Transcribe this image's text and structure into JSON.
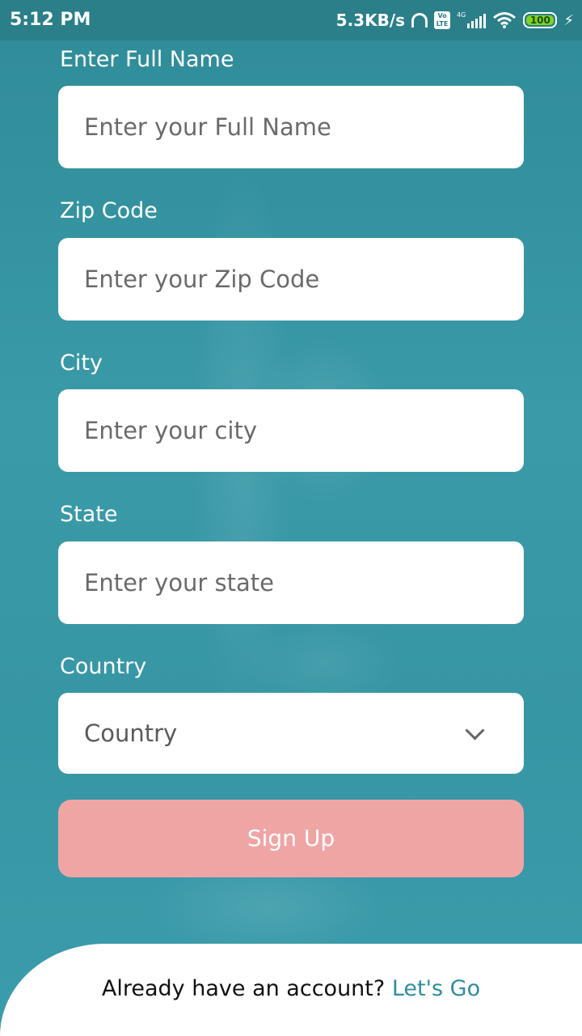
{
  "status_bar": {
    "time": "5:12 PM",
    "net_speed": "5.3KB/s",
    "volte_top": "Vo",
    "volte_bottom": "LTE",
    "network": "4G",
    "battery": "100"
  },
  "form": {
    "full_name": {
      "label": "Enter Full Name",
      "placeholder": "Enter your Full Name"
    },
    "zip_code": {
      "label": "Zip Code",
      "placeholder": "Enter your Zip Code"
    },
    "city": {
      "label": "City",
      "placeholder": "Enter your city"
    },
    "state": {
      "label": "State",
      "placeholder": "Enter your state"
    },
    "country": {
      "label": "Country",
      "selected": "Country"
    },
    "signup_label": "Sign Up"
  },
  "footer": {
    "prompt": "Already have an account?",
    "link": "Let's Go"
  },
  "colors": {
    "background": "#3a9aa8",
    "status_bar": "#2a7f89",
    "button": "#f0a5a5",
    "link": "#2e8e9e",
    "battery_fill": "#7ed321"
  }
}
